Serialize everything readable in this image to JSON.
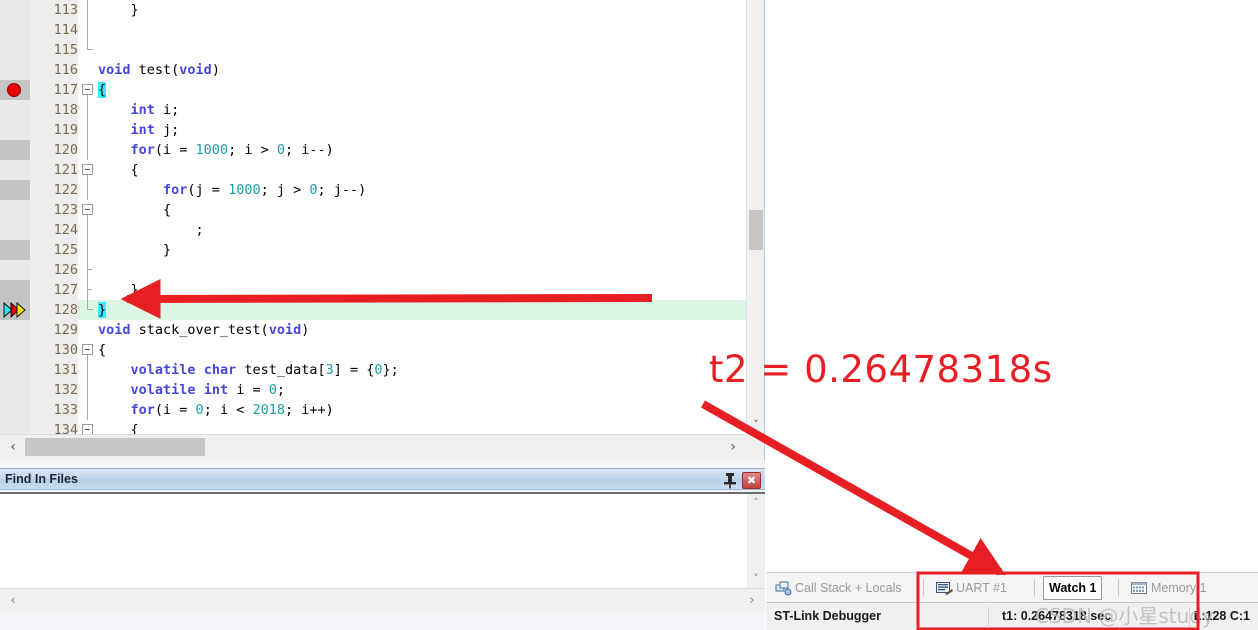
{
  "editor": {
    "lines": [
      {
        "n": "113",
        "marker": "none",
        "block": false,
        "fold": "end",
        "indent": 1,
        "tokens": [
          {
            "t": "}",
            "c": "plain"
          }
        ]
      },
      {
        "n": "114",
        "marker": "none",
        "block": false,
        "fold": "line",
        "indent": 0,
        "tokens": []
      },
      {
        "n": "115",
        "marker": "none",
        "block": false,
        "fold": "endtick",
        "indent": 0,
        "tokens": []
      },
      {
        "n": "116",
        "marker": "none",
        "block": false,
        "fold": "none",
        "indent": 0,
        "tokens": [
          {
            "t": "void",
            "c": "kw"
          },
          {
            "t": " test(",
            "c": "plain"
          },
          {
            "t": "void",
            "c": "kw"
          },
          {
            "t": ")",
            "c": "plain"
          }
        ]
      },
      {
        "n": "117",
        "marker": "breakpoint",
        "block": true,
        "fold": "box",
        "indent": 0,
        "tokens": [
          {
            "t": "{",
            "c": "sel"
          }
        ]
      },
      {
        "n": "118",
        "marker": "none",
        "block": false,
        "fold": "line",
        "indent": 1,
        "tokens": [
          {
            "t": "int",
            "c": "kw"
          },
          {
            "t": " i;",
            "c": "plain"
          }
        ]
      },
      {
        "n": "119",
        "marker": "none",
        "block": false,
        "fold": "line",
        "indent": 1,
        "tokens": [
          {
            "t": "int",
            "c": "kw"
          },
          {
            "t": " j;",
            "c": "plain"
          }
        ]
      },
      {
        "n": "120",
        "marker": "none",
        "block": true,
        "fold": "line",
        "indent": 1,
        "tokens": [
          {
            "t": "for",
            "c": "kw"
          },
          {
            "t": "(i = ",
            "c": "plain"
          },
          {
            "t": "1000",
            "c": "num"
          },
          {
            "t": "; i > ",
            "c": "plain"
          },
          {
            "t": "0",
            "c": "num"
          },
          {
            "t": "; i--)",
            "c": "plain"
          }
        ]
      },
      {
        "n": "121",
        "marker": "none",
        "block": false,
        "fold": "box",
        "indent": 1,
        "tokens": [
          {
            "t": "{",
            "c": "plain"
          }
        ]
      },
      {
        "n": "122",
        "marker": "none",
        "block": true,
        "fold": "line",
        "indent": 2,
        "tokens": [
          {
            "t": "for",
            "c": "kw"
          },
          {
            "t": "(j = ",
            "c": "plain"
          },
          {
            "t": "1000",
            "c": "num"
          },
          {
            "t": "; j > ",
            "c": "plain"
          },
          {
            "t": "0",
            "c": "num"
          },
          {
            "t": "; j--)",
            "c": "plain"
          }
        ]
      },
      {
        "n": "123",
        "marker": "none",
        "block": false,
        "fold": "box",
        "indent": 2,
        "tokens": [
          {
            "t": "{",
            "c": "plain"
          }
        ]
      },
      {
        "n": "124",
        "marker": "none",
        "block": false,
        "fold": "line",
        "indent": 3,
        "tokens": [
          {
            "t": ";",
            "c": "plain"
          }
        ]
      },
      {
        "n": "125",
        "marker": "none",
        "block": true,
        "fold": "line",
        "indent": 2,
        "tokens": [
          {
            "t": "}",
            "c": "plain"
          }
        ]
      },
      {
        "n": "126",
        "marker": "none",
        "block": false,
        "fold": "tick",
        "indent": 0,
        "tokens": []
      },
      {
        "n": "127",
        "marker": "none",
        "block": true,
        "fold": "tick",
        "indent": 1,
        "tokens": [
          {
            "t": "}",
            "c": "plain"
          }
        ]
      },
      {
        "n": "128",
        "marker": "exec",
        "block": true,
        "fold": "endtick",
        "indent": 0,
        "exec": true,
        "tokens": [
          {
            "t": "}",
            "c": "sel"
          }
        ]
      },
      {
        "n": "129",
        "marker": "none",
        "block": false,
        "fold": "none",
        "indent": 0,
        "tokens": [
          {
            "t": "void",
            "c": "kw"
          },
          {
            "t": " stack_over_test(",
            "c": "plain"
          },
          {
            "t": "void",
            "c": "kw"
          },
          {
            "t": ")",
            "c": "plain"
          }
        ]
      },
      {
        "n": "130",
        "marker": "none",
        "block": false,
        "fold": "box",
        "indent": 0,
        "tokens": [
          {
            "t": "{",
            "c": "plain"
          }
        ]
      },
      {
        "n": "131",
        "marker": "none",
        "block": false,
        "fold": "line",
        "indent": 1,
        "tokens": [
          {
            "t": "volatile",
            "c": "kw"
          },
          {
            "t": " ",
            "c": "plain"
          },
          {
            "t": "char",
            "c": "kw"
          },
          {
            "t": " test_data[",
            "c": "plain"
          },
          {
            "t": "3",
            "c": "num"
          },
          {
            "t": "] = {",
            "c": "plain"
          },
          {
            "t": "0",
            "c": "num"
          },
          {
            "t": "};",
            "c": "plain"
          }
        ]
      },
      {
        "n": "132",
        "marker": "none",
        "block": false,
        "fold": "line",
        "indent": 1,
        "tokens": [
          {
            "t": "volatile",
            "c": "kw"
          },
          {
            "t": " ",
            "c": "plain"
          },
          {
            "t": "int",
            "c": "kw"
          },
          {
            "t": " i = ",
            "c": "plain"
          },
          {
            "t": "0",
            "c": "num"
          },
          {
            "t": ";",
            "c": "plain"
          }
        ]
      },
      {
        "n": "133",
        "marker": "none",
        "block": false,
        "fold": "line",
        "indent": 1,
        "tokens": [
          {
            "t": "for",
            "c": "kw"
          },
          {
            "t": "(i = ",
            "c": "plain"
          },
          {
            "t": "0",
            "c": "num"
          },
          {
            "t": "; i < ",
            "c": "plain"
          },
          {
            "t": "2018",
            "c": "num"
          },
          {
            "t": "; i++)",
            "c": "plain"
          }
        ]
      },
      {
        "n": "134",
        "marker": "none",
        "block": false,
        "fold": "box",
        "indent": 1,
        "tokens": [
          {
            "t": "{",
            "c": "plain"
          }
        ]
      }
    ],
    "scroll_left_label": "‹",
    "scroll_right_label": "›",
    "scroll_up_label": "˄",
    "scroll_down_label": "˅"
  },
  "find_in_files": {
    "title": "Find In Files",
    "pin_icon": "pin-icon",
    "close_label": "✖",
    "scroll_up_label": "˄",
    "scroll_down_label": "˅",
    "scroll_left_label": "‹",
    "scroll_right_label": "›"
  },
  "tabs": [
    {
      "label": "Call Stack + Locals",
      "icon": "call-stack-icon",
      "active": false
    },
    {
      "label": "UART #1",
      "icon": "uart-icon",
      "active": false
    },
    {
      "label": "Watch 1",
      "icon": "none",
      "active": true
    },
    {
      "label": "Memory 1",
      "icon": "memory-icon",
      "active": false
    }
  ],
  "statusbar": {
    "debugger": "ST-Link Debugger",
    "time": "t1: 0.26478318 sec",
    "position": "L:128 C:1"
  },
  "annotations": {
    "text": "t2 = 0.26478318s",
    "color": "#e81e25",
    "watermark": "CSDN @小星study"
  },
  "colors": {
    "keyword": "#4646dc",
    "number": "#1d9ea8",
    "exec_line_bg": "#ddf5e3",
    "selection": "#33f0ff",
    "breakpoint": "#e60000",
    "annotation_red": "#e81e25"
  }
}
